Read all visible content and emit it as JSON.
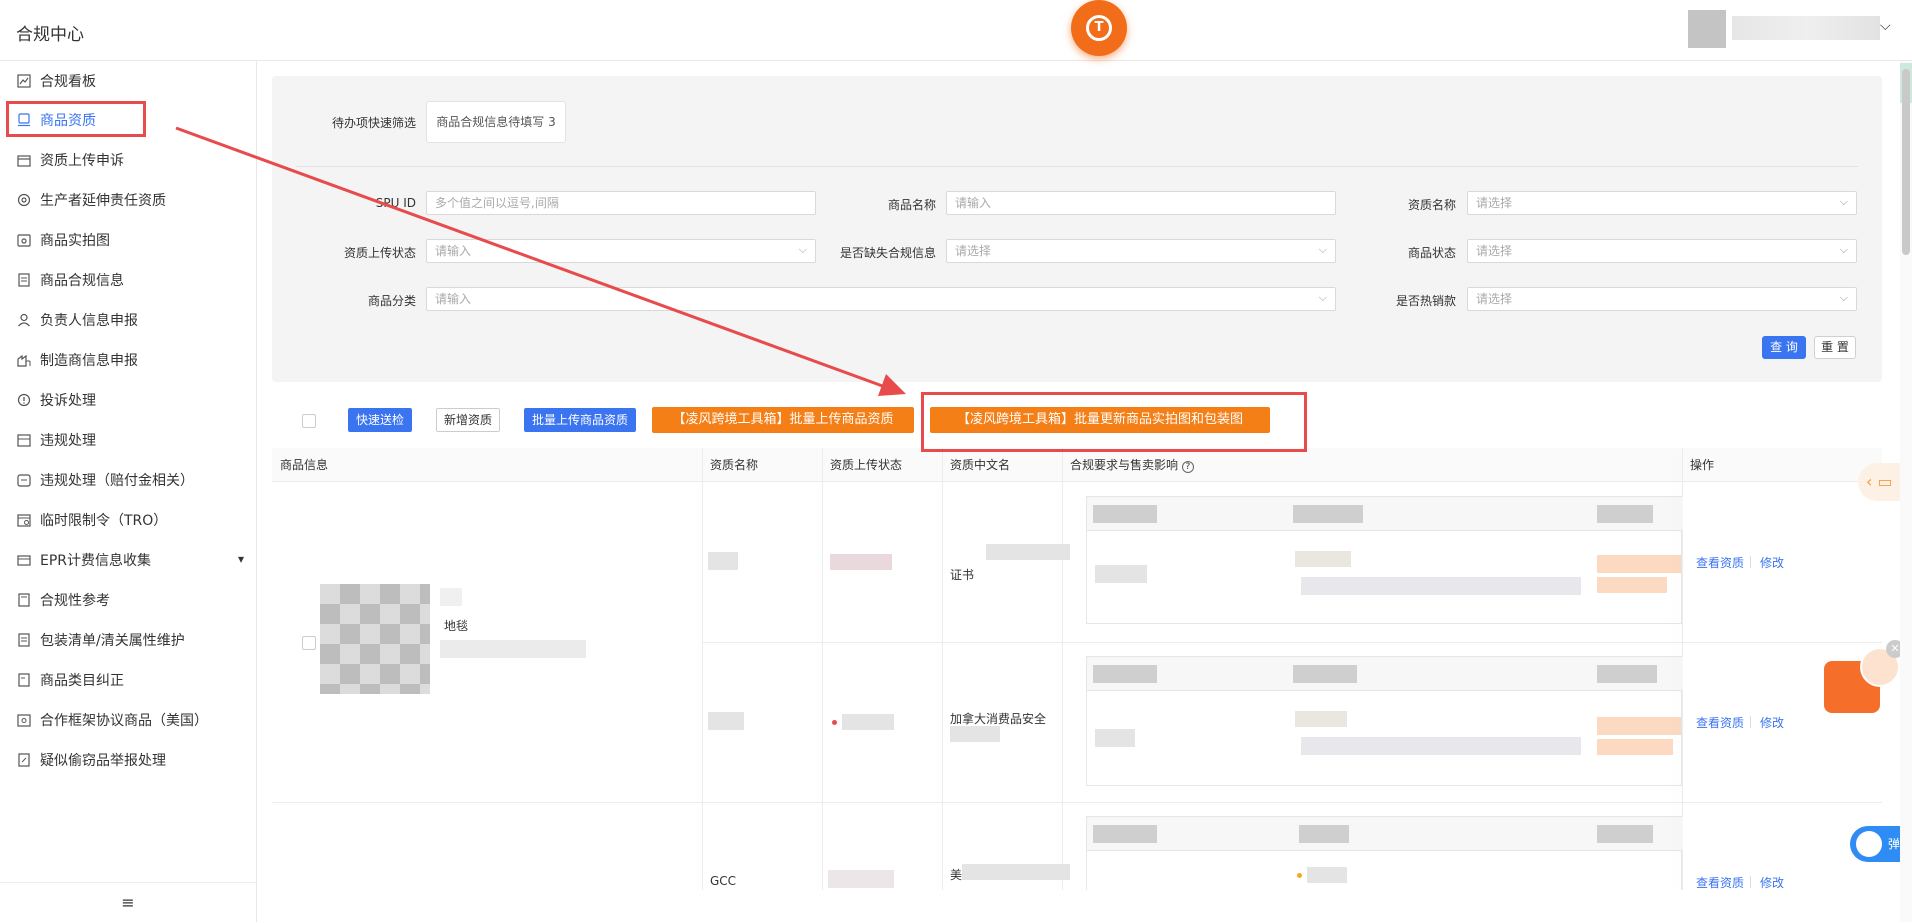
{
  "app": {
    "title": "合规中心",
    "logo_letter": "T"
  },
  "sidebar": {
    "items": [
      {
        "label": "合规看板",
        "icon": "chart-line-icon"
      },
      {
        "label": "商品资质",
        "icon": "certificate-icon",
        "active": true
      },
      {
        "label": "资质上传申诉",
        "icon": "upload-appeal-icon"
      },
      {
        "label": "生产者延伸责任资质",
        "icon": "recycle-icon"
      },
      {
        "label": "商品实拍图",
        "icon": "photo-icon"
      },
      {
        "label": "商品合规信息",
        "icon": "document-icon"
      },
      {
        "label": "负责人信息申报",
        "icon": "person-icon"
      },
      {
        "label": "制造商信息申报",
        "icon": "factory-icon"
      },
      {
        "label": "投诉处理",
        "icon": "warning-icon"
      },
      {
        "label": "违规处理",
        "icon": "stamp-icon"
      },
      {
        "label": "违规处理（赔付金相关）",
        "icon": "money-icon"
      },
      {
        "label": "临时限制令（TRO）",
        "icon": "calendar-icon"
      },
      {
        "label": "EPR计费信息收集",
        "icon": "bill-icon",
        "expandable": true
      },
      {
        "label": "合规性参考",
        "icon": "book-icon"
      },
      {
        "label": "包装清单/清关属性维护",
        "icon": "list-icon"
      },
      {
        "label": "商品类目纠正",
        "icon": "category-icon"
      },
      {
        "label": "合作框架协议商品（美国）",
        "icon": "contract-icon"
      },
      {
        "label": "疑似偷窃品举报处理",
        "icon": "report-icon"
      }
    ],
    "footer_icon": "collapse-menu-icon",
    "footer_glyph": "≡"
  },
  "filters": {
    "quick_label": "待办项快速筛选",
    "quick_chip": "商品合规信息待填写 3",
    "spu_label": "SPU ID",
    "spu_placeholder": "多个值之间以逗号,间隔",
    "product_name_label": "商品名称",
    "product_name_placeholder": "请输入",
    "qual_name_label": "资质名称",
    "qual_name_placeholder": "请选择",
    "upload_status_label": "资质上传状态",
    "upload_status_placeholder": "请输入",
    "missing_info_label": "是否缺失合规信息",
    "missing_info_placeholder": "请选择",
    "product_status_label": "商品状态",
    "product_status_placeholder": "请选择",
    "category_label": "商品分类",
    "category_placeholder": "请输入",
    "hot_label": "是否热销款",
    "hot_placeholder": "请选择",
    "query_button": "查 询",
    "reset_button": "重 置"
  },
  "toolbar": {
    "quick_check": "快速送检",
    "add_qual": "新增资质",
    "batch_upload": "批量上传商品资质",
    "tool_upload": "【凌风跨境工具箱】批量上传商品资质",
    "tool_update": "【凌风跨境工具箱】批量更新商品实拍图和包装图"
  },
  "table": {
    "headers": [
      "商品信息",
      "资质名称",
      "资质上传状态",
      "资质中文名",
      "合规要求与售卖影响",
      "操作"
    ],
    "help_icon": "question-circle-icon",
    "product_name": "地毯",
    "rows": [
      {
        "qual_cn": "证书",
        "action_view": "查看资质",
        "action_edit": "修改"
      },
      {
        "qual_cn": "加拿大消费品安全",
        "action_view": "查看资质",
        "action_edit": "修改"
      },
      {
        "qual_name": "GCC",
        "qual_cn": "美",
        "action_view": "查看资质",
        "action_edit": "修改"
      }
    ]
  },
  "widgets": {
    "toggle_label": "弹窗",
    "chat_icon": "chat-icon",
    "close_icon": "close-icon"
  },
  "colors": {
    "primary": "#3a74f0",
    "orange": "#f57f17",
    "annotation": "#e84b4b"
  }
}
